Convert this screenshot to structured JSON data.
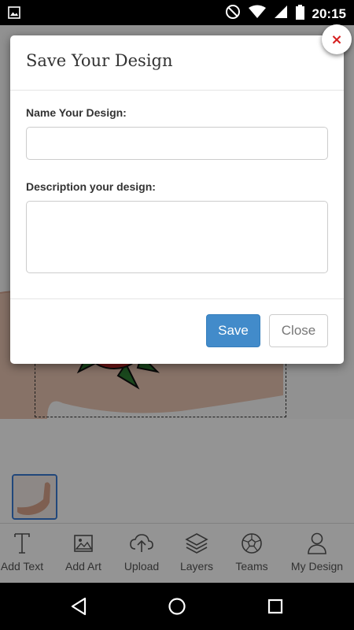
{
  "status_bar": {
    "time": "20:15",
    "icons": [
      "image-icon",
      "do-not-disturb-icon",
      "wifi-icon",
      "signal-icon",
      "battery-icon"
    ]
  },
  "toolbar": {
    "items": [
      {
        "label": "Add Text",
        "icon": "text-icon"
      },
      {
        "label": "Add Art",
        "icon": "image-icon"
      },
      {
        "label": "Upload",
        "icon": "cloud-upload-icon"
      },
      {
        "label": "Layers",
        "icon": "layers-icon"
      },
      {
        "label": "Teams",
        "icon": "soccer-ball-icon"
      },
      {
        "label": "My Design",
        "icon": "user-icon"
      }
    ]
  },
  "modal": {
    "title": "Save Your Design",
    "name_label": "Name Your Design:",
    "name_value": "",
    "name_placeholder": "",
    "description_label": "Description your design:",
    "description_value": "",
    "save_label": "Save",
    "close_label": "Close",
    "close_x": "×"
  },
  "colors": {
    "primary_button": "#428bca",
    "close_x": "#d61f1f",
    "thumbnail_border": "#3a7bd5"
  },
  "nav_bar": {
    "buttons": [
      "back-icon",
      "home-icon",
      "recents-icon"
    ]
  }
}
